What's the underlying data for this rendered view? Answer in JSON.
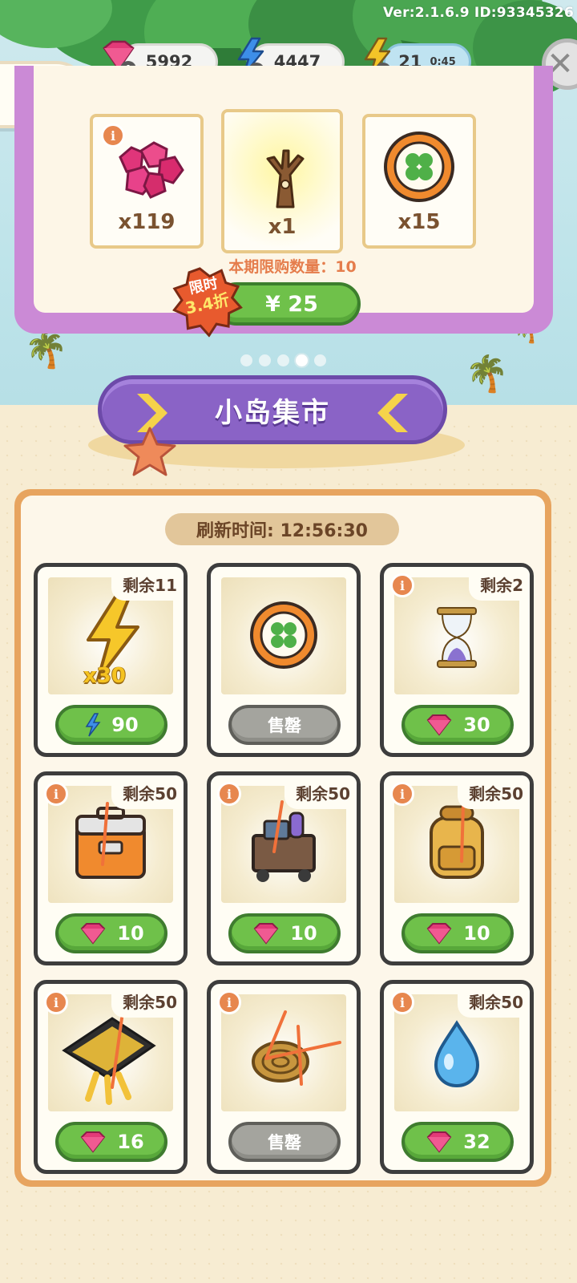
{
  "header": {
    "version": "Ver:2.1.6.9 ID:93345326",
    "resources": {
      "gems": "5992",
      "energy": "4447",
      "boost_count": "21",
      "boost_timer": "0:45"
    }
  },
  "featured_pack": {
    "rewards": [
      {
        "name": "gems",
        "qty": "x119"
      },
      {
        "name": "tree",
        "qty": "x1"
      },
      {
        "name": "clover-chip",
        "qty": "x15"
      }
    ],
    "limit_text": "本期限购数量：10",
    "price": "¥ 25",
    "discount_label": "限时",
    "discount_value": "3.4折"
  },
  "carousel": {
    "count": 5,
    "active_index": 3
  },
  "market": {
    "title": "小岛集市",
    "refresh_text": "刷新时间: 12:56:30",
    "items": [
      {
        "item": "energy-bolt",
        "stock": "剩余11",
        "qty_badge": "x30",
        "price": "90",
        "currency": "energy",
        "sold_out": false
      },
      {
        "item": "clover-chip",
        "stock": "",
        "price": "售罄",
        "currency": "",
        "sold_out": true
      },
      {
        "item": "hourglass",
        "stock": "剩余2",
        "price": "30",
        "currency": "gem",
        "sold_out": false
      },
      {
        "item": "tool-chest",
        "stock": "剩余50",
        "price": "10",
        "currency": "gem",
        "sold_out": false
      },
      {
        "item": "supply-cart",
        "stock": "剩余50",
        "price": "10",
        "currency": "gem",
        "sold_out": false
      },
      {
        "item": "backpack",
        "stock": "剩余50",
        "price": "10",
        "currency": "gem",
        "sold_out": false
      },
      {
        "item": "diving-fins",
        "stock": "剩余50",
        "price": "16",
        "currency": "gem",
        "sold_out": false
      },
      {
        "item": "rope-coil",
        "stock": "",
        "price": "售罄",
        "currency": "",
        "sold_out": true
      },
      {
        "item": "water-drop",
        "stock": "剩余50",
        "price": "32",
        "currency": "gem",
        "sold_out": false
      }
    ]
  },
  "colors": {
    "gem": "#e33a78",
    "button_green": "#6fc14a",
    "button_sold": "#a4a49e",
    "banner_purple": "#8a63c6",
    "panel_orange": "#e7a45f"
  }
}
